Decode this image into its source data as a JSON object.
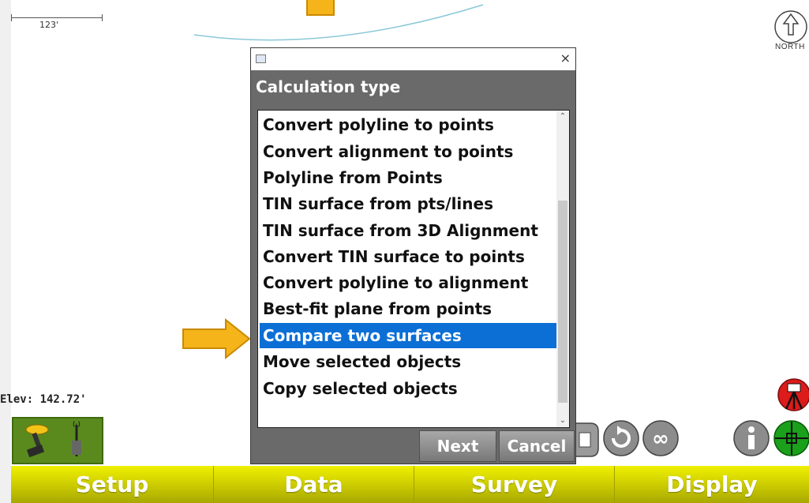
{
  "map": {
    "scale_label": "123'",
    "north_label": "NORTH",
    "elevation": "Elev: 142.72'"
  },
  "dialog": {
    "close_glyph": "×",
    "heading": "Calculation type",
    "items": [
      {
        "label": "Convert polyline to points"
      },
      {
        "label": "Convert alignment to points"
      },
      {
        "label": "Polyline from Points"
      },
      {
        "label": "TIN surface from pts/lines"
      },
      {
        "label": "TIN surface from 3D Alignment"
      },
      {
        "label": "Convert TIN surface to points"
      },
      {
        "label": "Convert polyline to alignment"
      },
      {
        "label": "Best-fit plane from points"
      },
      {
        "label": "Compare two surfaces"
      },
      {
        "label": "Move selected objects"
      },
      {
        "label": "Copy selected objects"
      }
    ],
    "selected_item": "Compare two surfaces",
    "next_label": "Next",
    "cancel_label": "Cancel"
  },
  "nav": {
    "setup": "Setup",
    "data": "Data",
    "survey": "Survey",
    "display": "Display"
  },
  "icons": {
    "north_arrow": "north-arrow-icon",
    "gps": "gps-receiver-icon",
    "info": "info-icon",
    "crosshair": "crosshair-icon",
    "rotate": "rotate-icon",
    "infinity": "infinity-icon",
    "tripod": "tripod-icon"
  },
  "colors": {
    "selection": "#0b6fd6",
    "nav_bar": "#d4d400",
    "callout": "#f4b41a"
  }
}
